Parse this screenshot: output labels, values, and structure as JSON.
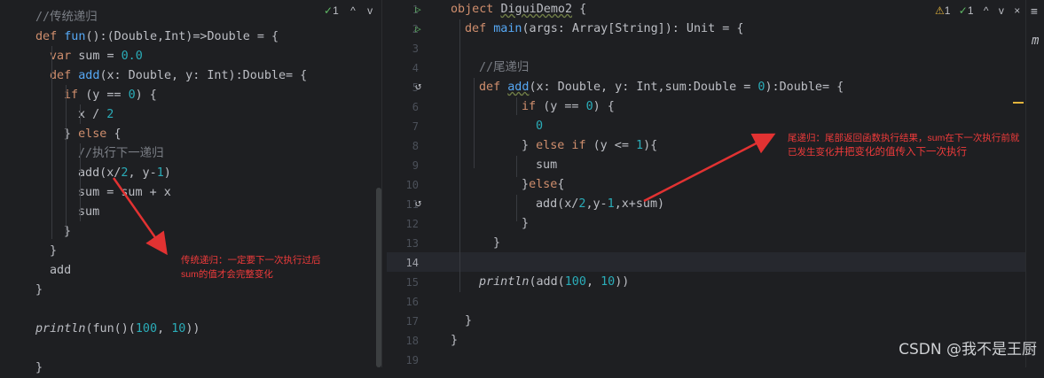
{
  "left_editor": {
    "inspection": {
      "check": "✓",
      "count": "1",
      "up": "^",
      "down": "v"
    },
    "lines": [
      {
        "indent": 0,
        "tokens": [
          {
            "t": "//传统递归",
            "c": "cm"
          }
        ]
      },
      {
        "indent": 0,
        "tokens": [
          {
            "t": "def ",
            "c": "kw"
          },
          {
            "t": "fun",
            "c": "fn"
          },
          {
            "t": "():(Double,Int)=>Double = {",
            "c": "plain"
          }
        ]
      },
      {
        "indent": 1,
        "tokens": [
          {
            "t": "var ",
            "c": "kw"
          },
          {
            "t": "sum = ",
            "c": "plain"
          },
          {
            "t": "0.0",
            "c": "num"
          }
        ]
      },
      {
        "indent": 1,
        "tokens": [
          {
            "t": "def ",
            "c": "kw"
          },
          {
            "t": "add",
            "c": "fn"
          },
          {
            "t": "(x: Double, y: Int):Double= {",
            "c": "plain"
          }
        ]
      },
      {
        "indent": 2,
        "tokens": [
          {
            "t": "if ",
            "c": "kw"
          },
          {
            "t": "(y == ",
            "c": "plain"
          },
          {
            "t": "0",
            "c": "num"
          },
          {
            "t": ") {",
            "c": "plain"
          }
        ]
      },
      {
        "indent": 3,
        "tokens": [
          {
            "t": "x / ",
            "c": "plain"
          },
          {
            "t": "2",
            "c": "num"
          }
        ]
      },
      {
        "indent": 2,
        "tokens": [
          {
            "t": "} ",
            "c": "plain"
          },
          {
            "t": "else ",
            "c": "kw"
          },
          {
            "t": "{",
            "c": "plain"
          }
        ]
      },
      {
        "indent": 3,
        "tokens": [
          {
            "t": "//执行下一递归",
            "c": "cm"
          }
        ]
      },
      {
        "indent": 3,
        "tokens": [
          {
            "t": "add(x/",
            "c": "plain"
          },
          {
            "t": "2",
            "c": "num"
          },
          {
            "t": ", y-",
            "c": "plain"
          },
          {
            "t": "1",
            "c": "num"
          },
          {
            "t": ")",
            "c": "plain"
          }
        ]
      },
      {
        "indent": 3,
        "tokens": [
          {
            "t": "sum = sum + x",
            "c": "plain"
          }
        ]
      },
      {
        "indent": 3,
        "tokens": [
          {
            "t": "sum",
            "c": "plain"
          }
        ]
      },
      {
        "indent": 2,
        "tokens": [
          {
            "t": "}",
            "c": "plain"
          }
        ]
      },
      {
        "indent": 1,
        "tokens": [
          {
            "t": "}",
            "c": "plain"
          }
        ]
      },
      {
        "indent": 1,
        "tokens": [
          {
            "t": "add",
            "c": "plain"
          }
        ]
      },
      {
        "indent": 0,
        "tokens": [
          {
            "t": "}",
            "c": "plain"
          }
        ]
      },
      {
        "indent": 0,
        "tokens": []
      },
      {
        "indent": 0,
        "tokens": [
          {
            "t": "println",
            "c": "plain it"
          },
          {
            "t": "(fun()(",
            "c": "plain"
          },
          {
            "t": "100",
            "c": "num"
          },
          {
            "t": ", ",
            "c": "plain"
          },
          {
            "t": "10",
            "c": "num"
          },
          {
            "t": "))",
            "c": "plain"
          }
        ]
      },
      {
        "indent": 0,
        "tokens": []
      },
      {
        "indent": 0,
        "tokens": [
          {
            "t": "}",
            "c": "plain"
          }
        ]
      }
    ]
  },
  "right_editor": {
    "inspection": {
      "warn_icon": "⚠",
      "warn_count": "1",
      "check": "✓",
      "check_count": "1",
      "up": "^",
      "down": "v",
      "close": "×"
    },
    "line_numbers": [
      "1",
      "2",
      "3",
      "4",
      "5",
      "6",
      "7",
      "8",
      "9",
      "10",
      "11",
      "12",
      "13",
      "14",
      "15",
      "16",
      "17",
      "18",
      "19"
    ],
    "lines": [
      {
        "indent": 0,
        "tokens": [
          {
            "t": "object ",
            "c": "kw"
          },
          {
            "t": "DiguiDemo2",
            "c": "plain ul"
          },
          {
            "t": " {",
            "c": "plain"
          }
        ]
      },
      {
        "indent": 1,
        "tokens": [
          {
            "t": "def ",
            "c": "kw"
          },
          {
            "t": "main",
            "c": "fn"
          },
          {
            "t": "(args: Array[String]): Unit = {",
            "c": "plain"
          }
        ]
      },
      {
        "indent": 0,
        "tokens": []
      },
      {
        "indent": 2,
        "tokens": [
          {
            "t": "//尾递归",
            "c": "cm"
          }
        ]
      },
      {
        "indent": 2,
        "tokens": [
          {
            "t": "def ",
            "c": "kw"
          },
          {
            "t": "add",
            "c": "fn ul"
          },
          {
            "t": "(x: Double, y: Int,sum:Double = ",
            "c": "plain"
          },
          {
            "t": "0",
            "c": "num"
          },
          {
            "t": "):Double= {",
            "c": "plain"
          }
        ]
      },
      {
        "indent": 5,
        "tokens": [
          {
            "t": "if ",
            "c": "kw"
          },
          {
            "t": "(y == ",
            "c": "plain"
          },
          {
            "t": "0",
            "c": "num"
          },
          {
            "t": ") {",
            "c": "plain"
          }
        ]
      },
      {
        "indent": 6,
        "tokens": [
          {
            "t": "0",
            "c": "num"
          }
        ]
      },
      {
        "indent": 5,
        "tokens": [
          {
            "t": "} ",
            "c": "plain"
          },
          {
            "t": "else if ",
            "c": "kw"
          },
          {
            "t": "(y <= ",
            "c": "plain"
          },
          {
            "t": "1",
            "c": "num"
          },
          {
            "t": "){",
            "c": "plain"
          }
        ]
      },
      {
        "indent": 6,
        "tokens": [
          {
            "t": "sum",
            "c": "plain"
          }
        ]
      },
      {
        "indent": 5,
        "tokens": [
          {
            "t": "}",
            "c": "plain"
          },
          {
            "t": "else",
            "c": "kw"
          },
          {
            "t": "{",
            "c": "plain"
          }
        ]
      },
      {
        "indent": 6,
        "tokens": [
          {
            "t": "add(x/",
            "c": "plain"
          },
          {
            "t": "2",
            "c": "num"
          },
          {
            "t": ",y-",
            "c": "plain"
          },
          {
            "t": "1",
            "c": "num"
          },
          {
            "t": ",x+sum)",
            "c": "plain"
          }
        ]
      },
      {
        "indent": 5,
        "tokens": [
          {
            "t": "}",
            "c": "plain"
          }
        ]
      },
      {
        "indent": 3,
        "tokens": [
          {
            "t": "}",
            "c": "plain"
          }
        ]
      },
      {
        "indent": 0,
        "tokens": []
      },
      {
        "indent": 2,
        "tokens": [
          {
            "t": "println",
            "c": "plain it"
          },
          {
            "t": "(add(",
            "c": "plain"
          },
          {
            "t": "100",
            "c": "num"
          },
          {
            "t": ", ",
            "c": "plain"
          },
          {
            "t": "10",
            "c": "num"
          },
          {
            "t": "))",
            "c": "plain"
          }
        ]
      },
      {
        "indent": 0,
        "tokens": []
      },
      {
        "indent": 1,
        "tokens": [
          {
            "t": "}",
            "c": "plain"
          }
        ]
      },
      {
        "indent": 0,
        "tokens": [
          {
            "t": "}",
            "c": "plain"
          }
        ]
      },
      {
        "indent": 0,
        "tokens": []
      }
    ]
  },
  "annotations": {
    "left_note_1": "传统递归：一定要下一次执行过后",
    "left_note_2": "sum的值才会完整变化",
    "right_note_1": "尾递归：尾部返回函数执行结果，sum在下一次执行前就",
    "right_note_2a": "已发生变化",
    "right_note_2b": "并把变化的值传入下一次执行"
  },
  "side_strip": {
    "db_icon": "≡",
    "m_label": "m"
  },
  "watermark": "CSDN @我不是王厨",
  "colors": {
    "background": "#1e1f22",
    "keyword": "#cf8e6d",
    "function": "#56a8f5",
    "number": "#2aacb8",
    "comment": "#7a7e85",
    "annotation": "#f03b3b"
  }
}
